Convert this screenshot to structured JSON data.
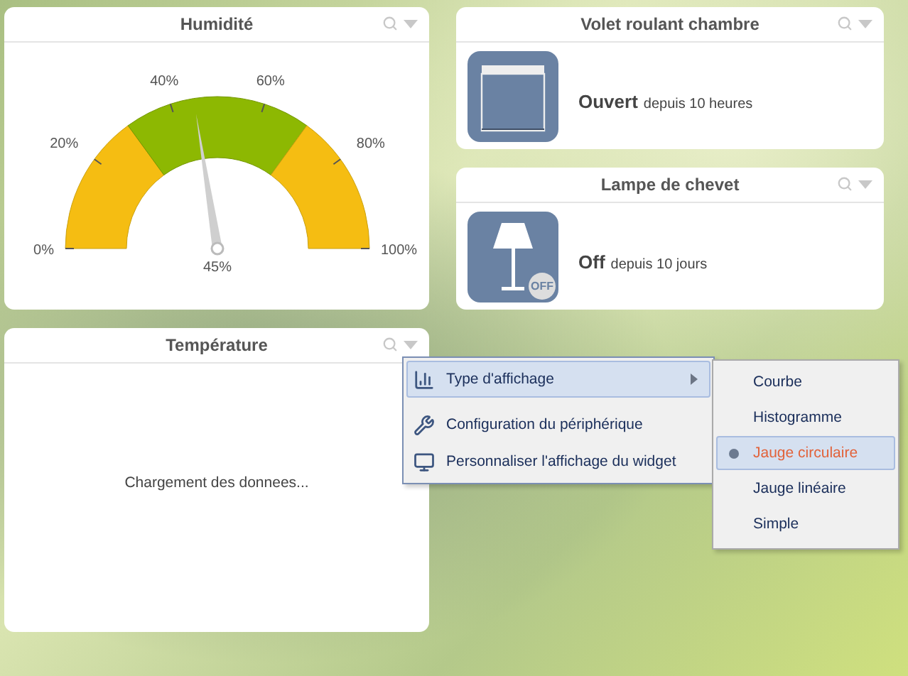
{
  "widgets": [
    {
      "kind": "gauge",
      "title": "Humidité",
      "level": 0.45,
      "reading": "45%",
      "ticks": [
        "0%",
        "20%",
        "40%",
        "60%",
        "80%",
        "100%"
      ]
    },
    {
      "kind": "shutter",
      "title": "Volet roulant chambre",
      "state": "Ouvert",
      "since": "depuis 10 heures"
    },
    {
      "kind": "lamp",
      "title": "Lampe de chevet",
      "state": "Off",
      "since": "depuis 10 jours",
      "badge": "OFF"
    },
    {
      "kind": "loading",
      "title": "Température",
      "message": "Chargement des donnees..."
    }
  ],
  "menu": {
    "items": [
      {
        "label": "Type d'affichage",
        "selected": true,
        "submenu": true
      },
      {
        "label": "Configuration du périphérique",
        "selected": false,
        "submenu": false
      },
      {
        "label": "Personnaliser l'affichage du widget",
        "selected": false,
        "submenu": false
      }
    ],
    "submenu": [
      {
        "label": "Courbe",
        "selected": false
      },
      {
        "label": "Histogramme",
        "selected": false
      },
      {
        "label": "Jauge circulaire",
        "selected": true
      },
      {
        "label": "Jauge linéaire",
        "selected": false
      },
      {
        "label": "Simple",
        "selected": false
      }
    ]
  }
}
